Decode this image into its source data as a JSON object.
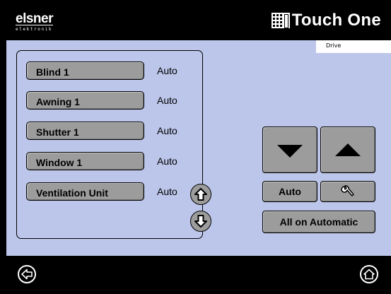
{
  "header": {
    "logo_name": "elsner",
    "logo_sub": "elektronik",
    "brand": "Touch One"
  },
  "main": {
    "section_label": "Drive",
    "drives": [
      {
        "label": "Blind 1",
        "status": "Auto"
      },
      {
        "label": "Awning 1",
        "status": "Auto"
      },
      {
        "label": "Shutter 1",
        "status": "Auto"
      },
      {
        "label": "Window 1",
        "status": "Auto"
      },
      {
        "label": "Ventilation Unit",
        "status": "Auto"
      }
    ],
    "controls": {
      "auto_label": "Auto",
      "all_auto_label": "All on Automatic"
    }
  },
  "icons": {
    "scroll_up": "arrow-up-outline-icon",
    "scroll_down": "arrow-down-outline-icon",
    "move_down": "triangle-down-icon",
    "move_up": "triangle-up-icon",
    "settings": "wrench-icon",
    "back": "arrow-left-icon",
    "home": "home-icon"
  },
  "colors": {
    "panel_bg": "#bcc6ea",
    "button_gray": "#9c9c9c",
    "chrome_bg": "#000000"
  }
}
